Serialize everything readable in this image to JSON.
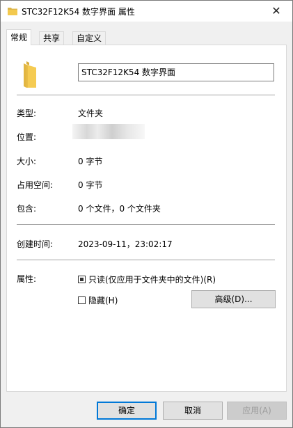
{
  "window": {
    "title": "STC32F12K54 数字界面 属性",
    "close_glyph": "✕"
  },
  "tabs": [
    {
      "label": "常规",
      "active": true
    },
    {
      "label": "共享",
      "active": false
    },
    {
      "label": "自定义",
      "active": false
    }
  ],
  "general": {
    "folder_name": "STC32F12K54 数字界面",
    "type_label": "类型:",
    "type_value": "文件夹",
    "location_label": "位置:",
    "size_label": "大小:",
    "size_value": "0 字节",
    "size_on_disk_label": "占用空间:",
    "size_on_disk_value": "0 字节",
    "contains_label": "包含:",
    "contains_value": "0 个文件，0 个文件夹",
    "created_label": "创建时间:",
    "created_value": "2023-09-11，23:02:17",
    "attributes_label": "属性:",
    "readonly_label": "只读(仅应用于文件夹中的文件)(R)",
    "readonly_state": "indeterminate",
    "hidden_label": "隐藏(H)",
    "hidden_state": "unchecked",
    "advanced_label": "高级(D)..."
  },
  "footer": {
    "ok_label": "确定",
    "cancel_label": "取消",
    "apply_label": "应用(A)"
  },
  "colors": {
    "folder": "#f0c14b",
    "accent": "#0078d7"
  }
}
